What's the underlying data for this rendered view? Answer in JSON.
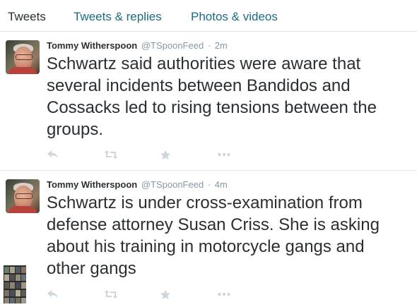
{
  "tabs": [
    {
      "label": "Tweets",
      "active": true
    },
    {
      "label": "Tweets & replies",
      "active": false
    },
    {
      "label": "Photos & videos",
      "active": false
    }
  ],
  "tweets": [
    {
      "fullname": "Tommy Witherspoon",
      "username": "@TSpoonFeed",
      "separator": "·",
      "time": "2m",
      "text": "Schwartz said authorities were aware that several incidents between Bandidos and Cossacks led to rising tensions between the groups.",
      "has_media": false
    },
    {
      "fullname": "Tommy Witherspoon",
      "username": "@TSpoonFeed",
      "separator": "·",
      "time": "4m",
      "text": "Schwartz  is under cross-examination from defense attorney Susan Criss. She is asking about his training in motorcycle gangs and other gangs",
      "has_media": true
    }
  ],
  "actions": [
    "reply-icon",
    "retweet-icon",
    "favorite-icon",
    "more-icon"
  ],
  "colors": {
    "tab_active": "#292f33",
    "tab_inactive": "#1b6b83",
    "text": "#292f33",
    "meta": "#8899a6",
    "icon": "#ccd6dd",
    "divider": "#e1e8ed"
  }
}
